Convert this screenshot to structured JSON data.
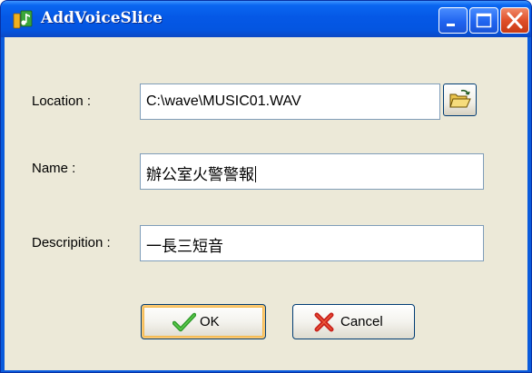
{
  "window": {
    "title": "AddVoiceSlice",
    "icon": "music-note-app-icon",
    "controls": [
      "minimize",
      "maximize",
      "close"
    ]
  },
  "form": {
    "location_label": "Location :",
    "location_value": "C:\\wave\\MUSIC01.WAV",
    "name_label": "Name :",
    "name_value": "辦公室火警警報",
    "description_label": "Descripition :",
    "description_value": "一長三短音"
  },
  "buttons": {
    "ok_label": "OK",
    "cancel_label": "Cancel"
  },
  "colors": {
    "titlebar": "#0558e6",
    "dialog_background": "#ece9d8",
    "close_button": "#e0502a",
    "ok_check": "#2e9a2a",
    "cancel_x": "#c8201a"
  }
}
